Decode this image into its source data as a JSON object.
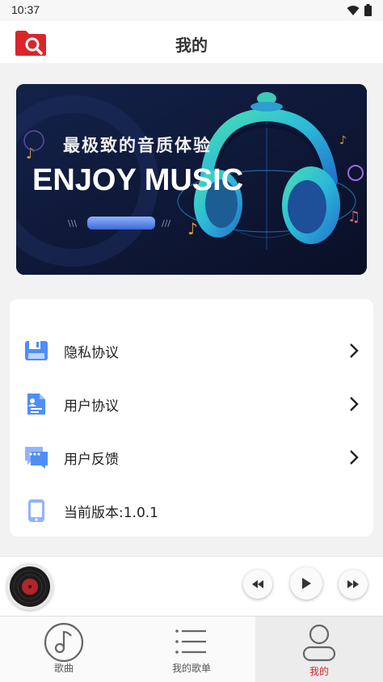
{
  "status_bar": {
    "time": "10:37"
  },
  "header": {
    "title": "我的"
  },
  "banner": {
    "subtitle": "最极致的音质体验",
    "title": "ENJOY MUSIC"
  },
  "menu": [
    {
      "label": "隐私协议",
      "icon": "privacy-icon"
    },
    {
      "label": "用户协议",
      "icon": "user-agreement-icon"
    },
    {
      "label": "用户反馈",
      "icon": "feedback-icon"
    },
    {
      "label": "当前版本:1.0.1",
      "icon": "phone-icon"
    }
  ],
  "tabs": [
    {
      "label": "歌曲",
      "icon": "music-note-icon"
    },
    {
      "label": "我的歌单",
      "icon": "playlist-icon"
    },
    {
      "label": "我的",
      "icon": "profile-icon",
      "active": true
    }
  ],
  "colors": {
    "accent": "#d9262b",
    "icon_blue": "#4f8ef7"
  }
}
